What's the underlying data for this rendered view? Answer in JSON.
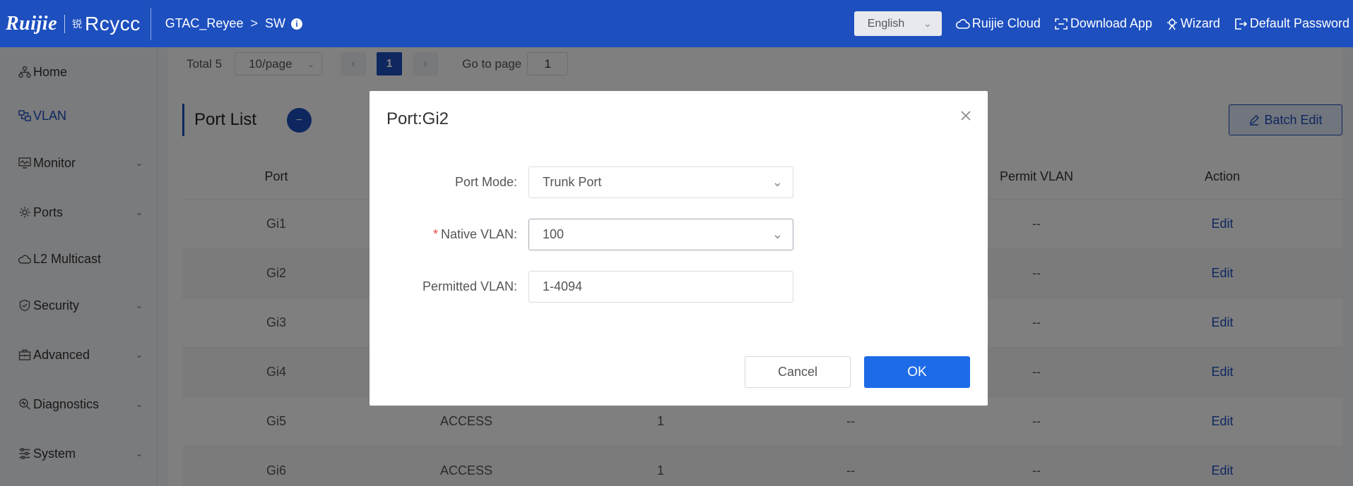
{
  "header": {
    "logo_primary": "Ruijie",
    "logo_secondary_mark": "锐",
    "logo_secondary": "Rcycc",
    "breadcrumb": [
      "GTAC_Reyee",
      "SW"
    ],
    "language": "English",
    "links": [
      {
        "label": "Ruijie Cloud",
        "icon": "cloud-icon"
      },
      {
        "label": "Download App",
        "icon": "download-app-icon"
      },
      {
        "label": "Wizard",
        "icon": "wizard-icon"
      },
      {
        "label": "Default Password",
        "icon": "logout-icon"
      }
    ]
  },
  "sidebar": {
    "items": [
      {
        "label": "Home",
        "icon": "home-icon",
        "expandable": false
      },
      {
        "label": "VLAN",
        "icon": "vlan-icon",
        "expandable": false,
        "active": true
      },
      {
        "label": "Monitor",
        "icon": "monitor-icon",
        "expandable": true
      },
      {
        "label": "Ports",
        "icon": "ports-gear-icon",
        "expandable": true
      },
      {
        "label": "L2 Multicast",
        "icon": "multicast-cloud-icon",
        "expandable": false
      },
      {
        "label": "Security",
        "icon": "shield-icon",
        "expandable": true
      },
      {
        "label": "Advanced",
        "icon": "toolbox-icon",
        "expandable": true
      },
      {
        "label": "Diagnostics",
        "icon": "diagnostics-icon",
        "expandable": true
      },
      {
        "label": "System",
        "icon": "sliders-icon",
        "expandable": true
      }
    ]
  },
  "pagination": {
    "total_label": "Total 5",
    "page_size": "10/page",
    "current_page": "1",
    "goto_label": "Go to page",
    "goto_value": "1"
  },
  "port_list": {
    "title": "Port List",
    "batch_edit_label": "Batch Edit",
    "columns": [
      "Port",
      "",
      "",
      "",
      "Permit VLAN",
      "Action"
    ],
    "rows": [
      {
        "port": "Gi1",
        "mode": "",
        "vlan": "",
        "native": "",
        "permit": "--",
        "action": "Edit"
      },
      {
        "port": "Gi2",
        "mode": "",
        "vlan": "",
        "native": "",
        "permit": "--",
        "action": "Edit"
      },
      {
        "port": "Gi3",
        "mode": "",
        "vlan": "",
        "native": "",
        "permit": "--",
        "action": "Edit"
      },
      {
        "port": "Gi4",
        "mode": "",
        "vlan": "",
        "native": "",
        "permit": "--",
        "action": "Edit"
      },
      {
        "port": "Gi5",
        "mode": "ACCESS",
        "vlan": "1",
        "native": "--",
        "permit": "--",
        "action": "Edit"
      },
      {
        "port": "Gi6",
        "mode": "ACCESS",
        "vlan": "1",
        "native": "--",
        "permit": "--",
        "action": "Edit"
      }
    ]
  },
  "modal": {
    "title": "Port:Gi2",
    "port_mode_label": "Port Mode:",
    "port_mode_value": "Trunk Port",
    "native_vlan_required": "*",
    "native_vlan_label": "Native VLAN:",
    "native_vlan_value": "100",
    "permitted_vlan_label": "Permitted VLAN:",
    "permitted_vlan_value": "1-4094",
    "cancel_label": "Cancel",
    "ok_label": "OK"
  },
  "colors": {
    "brand_blue": "#1d4fbf",
    "primary_button": "#1e6be8",
    "required": "#e34d4d"
  }
}
